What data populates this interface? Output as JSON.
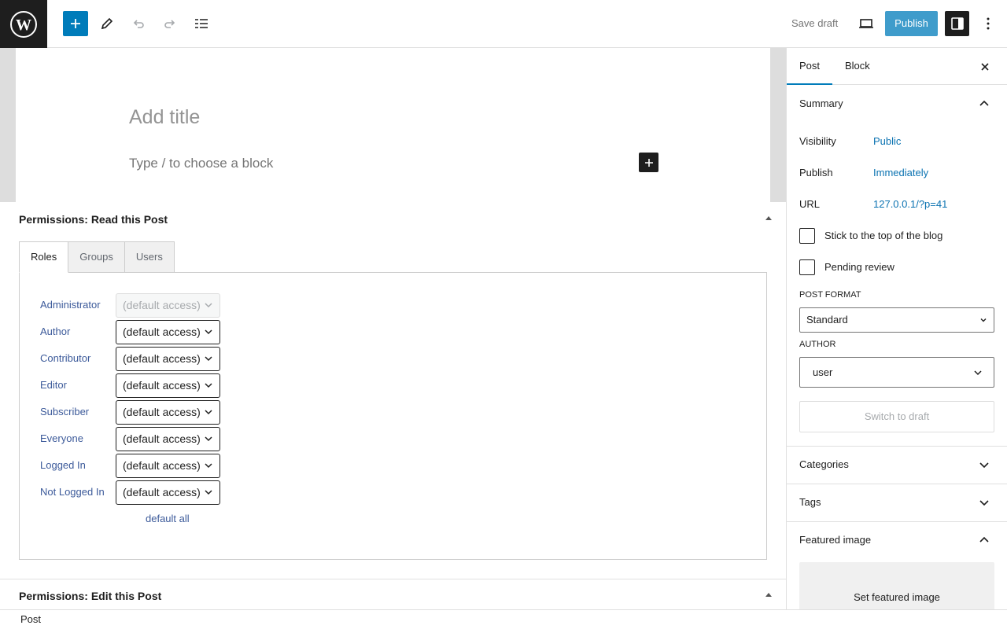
{
  "toolbar": {
    "save_draft_label": "Save draft",
    "publish_label": "Publish"
  },
  "editor": {
    "title_placeholder": "Add title",
    "block_placeholder": "Type / to choose a block"
  },
  "metabox_read": {
    "title": "Permissions: Read this Post",
    "tabs": [
      "Roles",
      "Groups",
      "Users"
    ],
    "roles": [
      {
        "label": "Administrator",
        "value": "(default access)"
      },
      {
        "label": "Author",
        "value": "(default access)"
      },
      {
        "label": "Contributor",
        "value": "(default access)"
      },
      {
        "label": "Editor",
        "value": "(default access)"
      },
      {
        "label": "Subscriber",
        "value": "(default access)"
      },
      {
        "label": "Everyone",
        "value": "(default access)"
      },
      {
        "label": "Logged In",
        "value": "(default access)"
      },
      {
        "label": "Not Logged In",
        "value": "(default access)"
      }
    ],
    "default_all_label": "default all"
  },
  "metabox_edit": {
    "title": "Permissions: Edit this Post"
  },
  "statusbar": {
    "label": "Post"
  },
  "sidebar": {
    "tabs": [
      "Post",
      "Block"
    ],
    "summary": {
      "title": "Summary",
      "visibility_label": "Visibility",
      "visibility_value": "Public",
      "publish_label": "Publish",
      "publish_value": "Immediately",
      "url_label": "URL",
      "url_value": "127.0.0.1/?p=41",
      "sticky_label": "Stick to the top of the blog",
      "pending_label": "Pending review",
      "post_format_label": "POST FORMAT",
      "post_format_value": "Standard",
      "author_label": "AUTHOR",
      "author_value": "user",
      "switch_draft_label": "Switch to draft"
    },
    "categories_label": "Categories",
    "tags_label": "Tags",
    "featured_image_label": "Featured image",
    "set_featured_label": "Set featured image"
  },
  "colors": {
    "accent": "#007cba",
    "dark": "#1e1e1e",
    "link": "#0a72b1"
  }
}
